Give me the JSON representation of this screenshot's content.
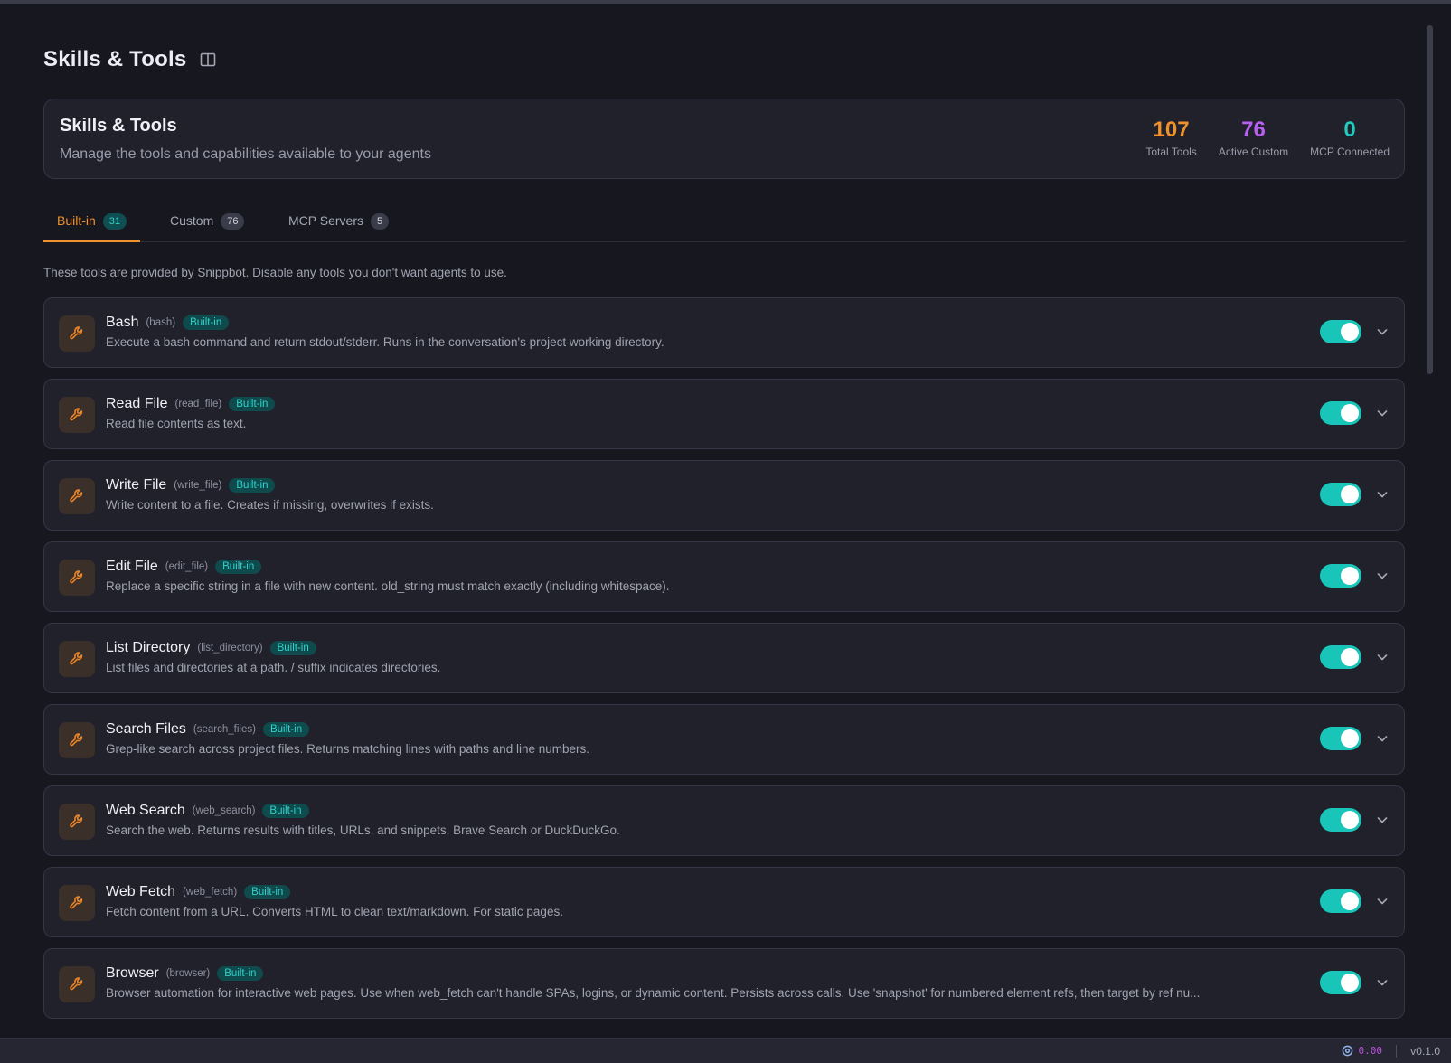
{
  "page": {
    "title": "Skills & Tools"
  },
  "summary": {
    "title": "Skills & Tools",
    "subtitle": "Manage the tools and capabilities available to your agents",
    "stats": [
      {
        "value": "107",
        "label": "Total Tools",
        "color": "#f0922b"
      },
      {
        "value": "76",
        "label": "Active Custom",
        "color": "#b660f0"
      },
      {
        "value": "0",
        "label": "MCP Connected",
        "color": "#24c9c0"
      }
    ]
  },
  "tabs": [
    {
      "label": "Built-in",
      "count": "31",
      "active": true
    },
    {
      "label": "Custom",
      "count": "76",
      "active": false
    },
    {
      "label": "MCP Servers",
      "count": "5",
      "active": false
    }
  ],
  "hint": "These tools are provided by Snippbot. Disable any tools you don't want agents to use.",
  "tools": [
    {
      "name": "Bash",
      "id": "(bash)",
      "badge": "Built-in",
      "desc": "Execute a bash command and return stdout/stderr. Runs in the conversation's project working directory.",
      "enabled": true
    },
    {
      "name": "Read File",
      "id": "(read_file)",
      "badge": "Built-in",
      "desc": "Read file contents as text.",
      "enabled": true
    },
    {
      "name": "Write File",
      "id": "(write_file)",
      "badge": "Built-in",
      "desc": "Write content to a file. Creates if missing, overwrites if exists.",
      "enabled": true
    },
    {
      "name": "Edit File",
      "id": "(edit_file)",
      "badge": "Built-in",
      "desc": "Replace a specific string in a file with new content. old_string must match exactly (including whitespace).",
      "enabled": true
    },
    {
      "name": "List Directory",
      "id": "(list_directory)",
      "badge": "Built-in",
      "desc": "List files and directories at a path. / suffix indicates directories.",
      "enabled": true
    },
    {
      "name": "Search Files",
      "id": "(search_files)",
      "badge": "Built-in",
      "desc": "Grep-like search across project files. Returns matching lines with paths and line numbers.",
      "enabled": true
    },
    {
      "name": "Web Search",
      "id": "(web_search)",
      "badge": "Built-in",
      "desc": "Search the web. Returns results with titles, URLs, and snippets. Brave Search or DuckDuckGo.",
      "enabled": true
    },
    {
      "name": "Web Fetch",
      "id": "(web_fetch)",
      "badge": "Built-in",
      "desc": "Fetch content from a URL. Converts HTML to clean text/markdown. For static pages.",
      "enabled": true
    },
    {
      "name": "Browser",
      "id": "(browser)",
      "badge": "Built-in",
      "desc": "Browser automation for interactive web pages. Use when web_fetch can't handle SPAs, logins, or dynamic content. Persists across calls. Use 'snapshot' for numbered element refs, then target by ref nu...",
      "enabled": true
    }
  ],
  "statusbar": {
    "cost": "0.00",
    "version": "v0.1.0"
  }
}
